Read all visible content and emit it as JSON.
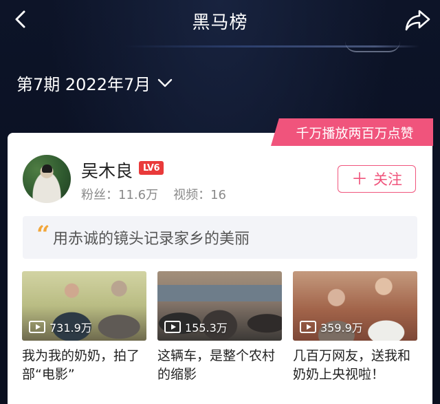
{
  "header": {
    "title": "黑马榜",
    "back_icon": "chevron-left-icon",
    "share_icon": "share-arrow-icon"
  },
  "period": {
    "label": "第7期 2022年7月",
    "dropdown_icon": "chevron-down-icon"
  },
  "card": {
    "badge": "千万播放两百万点赞",
    "creator": {
      "name": "吴木良",
      "level": "LV6",
      "fans_label": "粉丝：",
      "fans_value": "11.6万",
      "videos_label": "视频：",
      "videos_value": "16",
      "follow_label": "关注"
    },
    "quote": "用赤诚的镜头记录家乡的美丽",
    "videos": [
      {
        "plays": "731.9万",
        "title": "我为我的奶奶，拍了部“电影”"
      },
      {
        "plays": "155.3万",
        "title": "这辆车，是整个农村的缩影"
      },
      {
        "plays": "359.9万",
        "title": "几百万网友，送我和奶奶上央视啦！"
      }
    ]
  },
  "colors": {
    "background": "#0a1023",
    "accent_pink": "#f0547c",
    "level_red": "#e93a3a",
    "quote_orange": "#f2a63a"
  }
}
